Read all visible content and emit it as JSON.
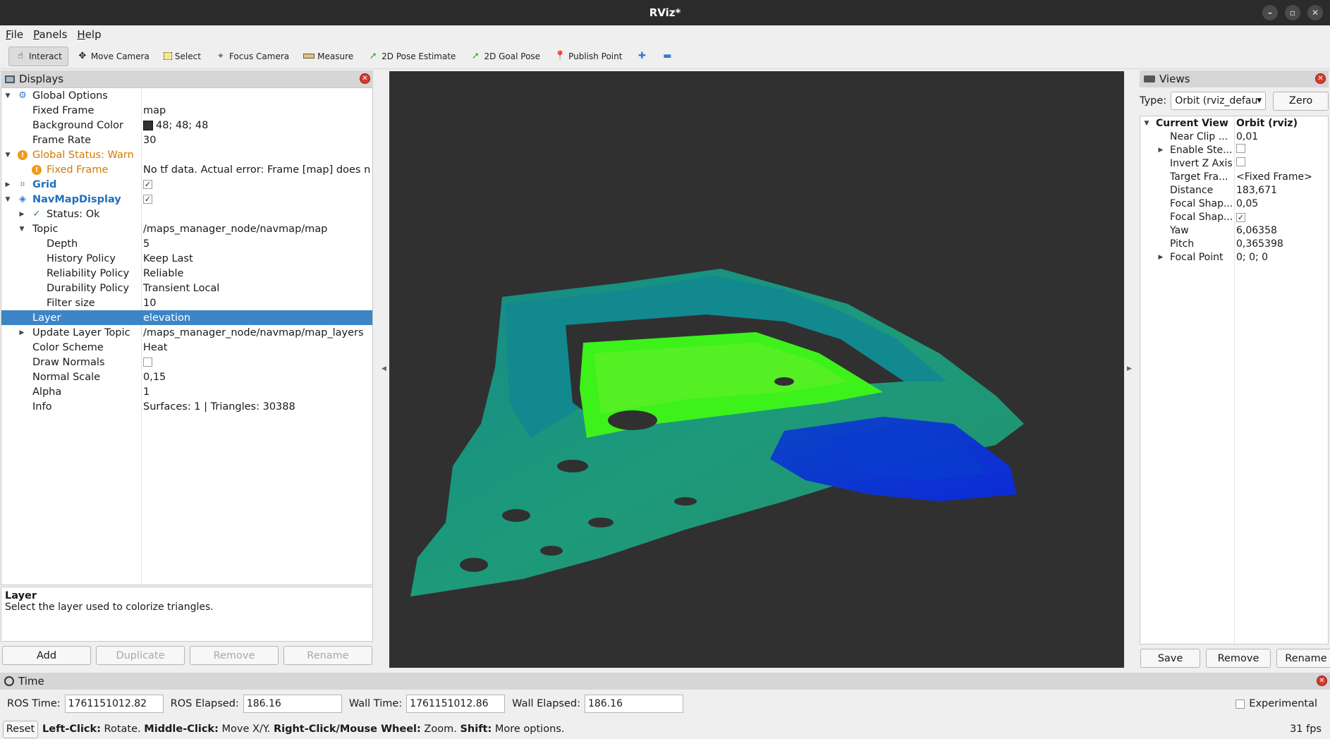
{
  "window": {
    "title": "RViz*"
  },
  "menu": [
    "File",
    "Panels",
    "Help"
  ],
  "toolbar": {
    "tools": [
      {
        "label": "Interact",
        "icon": "hand-icon",
        "active": true
      },
      {
        "label": "Move Camera",
        "icon": "move-icon"
      },
      {
        "label": "Select",
        "icon": "select-box-icon"
      },
      {
        "label": "Focus Camera",
        "icon": "crosshair-icon"
      },
      {
        "label": "Measure",
        "icon": "ruler-icon"
      },
      {
        "label": "2D Pose Estimate",
        "icon": "green-arrow-icon"
      },
      {
        "label": "2D Goal Pose",
        "icon": "green-arrow-icon"
      },
      {
        "label": "Publish Point",
        "icon": "pin-icon"
      }
    ]
  },
  "displays": {
    "title": "Displays",
    "rows": [
      {
        "name": "Global Options",
        "value": ""
      },
      {
        "name": "Fixed Frame",
        "value": "map"
      },
      {
        "name": "Background Color",
        "value": "48; 48; 48"
      },
      {
        "name": "Frame Rate",
        "value": "30"
      },
      {
        "name": "Global Status: Warn",
        "value": ""
      },
      {
        "name": "Fixed Frame",
        "value": "No tf data.  Actual error: Frame [map] does no..."
      },
      {
        "name": "Grid",
        "value": ""
      },
      {
        "name": "NavMapDisplay",
        "value": ""
      },
      {
        "name": "Status: Ok",
        "value": ""
      },
      {
        "name": "Topic",
        "value": "/maps_manager_node/navmap/map"
      },
      {
        "name": "Depth",
        "value": "5"
      },
      {
        "name": "History Policy",
        "value": "Keep Last"
      },
      {
        "name": "Reliability Policy",
        "value": "Reliable"
      },
      {
        "name": "Durability Policy",
        "value": "Transient Local"
      },
      {
        "name": "Filter size",
        "value": "10"
      },
      {
        "name": "Layer",
        "value": "elevation"
      },
      {
        "name": "Update Layer Topic",
        "value": "/maps_manager_node/navmap/map_layers"
      },
      {
        "name": "Color Scheme",
        "value": "Heat"
      },
      {
        "name": "Draw Normals",
        "value": ""
      },
      {
        "name": "Normal Scale",
        "value": "0,15"
      },
      {
        "name": "Alpha",
        "value": "1"
      },
      {
        "name": "Info",
        "value": "Surfaces: 1 | Triangles: 30388"
      }
    ],
    "grid_checked": true,
    "navmap_checked": true,
    "draw_normals_checked": false,
    "selected_row": "Layer"
  },
  "description": {
    "title": "Layer",
    "text": "Select the layer used to colorize triangles."
  },
  "display_buttons": [
    "Add",
    "Duplicate",
    "Remove",
    "Rename"
  ],
  "views": {
    "title": "Views",
    "type_label": "Type:",
    "type_value": "Orbit (rviz_defau",
    "zero_label": "Zero",
    "header": {
      "name": "Current View",
      "value": "Orbit (rviz)"
    },
    "rows": [
      {
        "name": "Near Clip ...",
        "value": "0,01"
      },
      {
        "name": "Enable Ste...",
        "value": ""
      },
      {
        "name": "Invert Z Axis",
        "value": ""
      },
      {
        "name": "Target Fra...",
        "value": "<Fixed Frame>"
      },
      {
        "name": "Distance",
        "value": "183,671"
      },
      {
        "name": "Focal Shap...",
        "value": "0,05"
      },
      {
        "name": "Focal Shap...",
        "value": ""
      },
      {
        "name": "Yaw",
        "value": "6,06358"
      },
      {
        "name": "Pitch",
        "value": "0,365398"
      },
      {
        "name": "Focal Point",
        "value": "0; 0; 0"
      }
    ],
    "buttons": [
      "Save",
      "Remove",
      "Rename"
    ]
  },
  "time": {
    "title": "Time",
    "ros_time_label": "ROS Time:",
    "ros_time": "1761151012.82",
    "ros_elapsed_label": "ROS Elapsed:",
    "ros_elapsed": "186.16",
    "wall_time_label": "Wall Time:",
    "wall_time": "1761151012.86",
    "wall_elapsed_label": "Wall Elapsed:",
    "wall_elapsed": "186.16",
    "experimental_label": "Experimental"
  },
  "status": {
    "reset": "Reset",
    "hint_parts": [
      "Left-Click:",
      " Rotate. ",
      "Middle-Click:",
      " Move X/Y. ",
      "Right-Click/Mouse Wheel:",
      " Zoom. ",
      "Shift:",
      " More options."
    ],
    "fps": "31 fps"
  }
}
